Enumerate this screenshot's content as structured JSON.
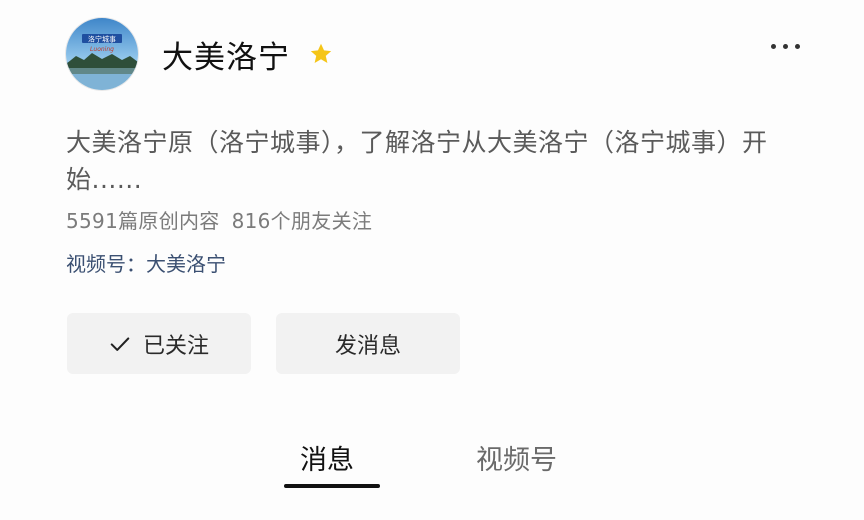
{
  "profile": {
    "name": "大美洛宁",
    "description": "大美洛宁原（洛宁城事），了解洛宁从大美洛宁（洛宁城事）开始......",
    "stats": {
      "original_count": "5591篇原创内容",
      "followers": "816个朋友关注"
    },
    "channel": "视频号：大美洛宁",
    "avatar_logo_text": "洛宁城事",
    "avatar_logo_subtext": "Luoning"
  },
  "actions": {
    "follow_label": "已关注",
    "message_label": "发消息"
  },
  "tabs": {
    "items": [
      "消息",
      "视频号"
    ],
    "active_index": 0
  },
  "colors": {
    "star": "#f5c518",
    "channel_text": "#3b5072",
    "button_bg": "#f2f2f2"
  },
  "icons": {
    "star": "star-icon",
    "more": "more-icon",
    "check": "check-icon"
  }
}
